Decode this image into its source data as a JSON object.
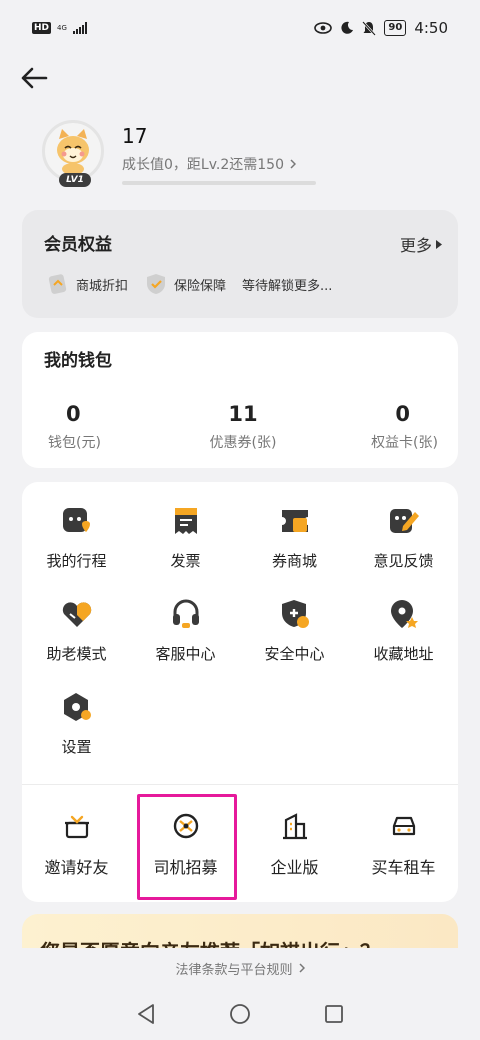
{
  "status_bar": {
    "hd": "HD",
    "network": "4G",
    "battery": "90",
    "time": "4:50"
  },
  "profile": {
    "phone": "17",
    "level_badge": "LV1",
    "growth_text": "成长值0，距Lv.2还需150",
    "growth_progress": 0
  },
  "member": {
    "title": "会员权益",
    "more": "更多",
    "benefits": [
      "商城折扣",
      "保险保障",
      "等待解锁更多..."
    ]
  },
  "wallet": {
    "title": "我的钱包",
    "stats": [
      {
        "value": "0",
        "label": "钱包(元)"
      },
      {
        "value": "11",
        "label": "优惠券(张)"
      },
      {
        "value": "0",
        "label": "权益卡(张)"
      }
    ]
  },
  "services": {
    "items": [
      {
        "label": "我的行程",
        "icon": "trip-icon"
      },
      {
        "label": "发票",
        "icon": "invoice-icon"
      },
      {
        "label": "券商城",
        "icon": "coupon-mall-icon"
      },
      {
        "label": "意见反馈",
        "icon": "feedback-icon"
      },
      {
        "label": "助老模式",
        "icon": "elder-mode-icon"
      },
      {
        "label": "客服中心",
        "icon": "headset-icon"
      },
      {
        "label": "安全中心",
        "icon": "shield-icon"
      },
      {
        "label": "收藏地址",
        "icon": "location-pin-icon"
      },
      {
        "label": "设置",
        "icon": "settings-icon"
      }
    ],
    "secondary": [
      {
        "label": "邀请好友",
        "icon": "gift-icon"
      },
      {
        "label": "司机招募",
        "icon": "steering-wheel-icon"
      },
      {
        "label": "企业版",
        "icon": "building-icon"
      },
      {
        "label": "买车租车",
        "icon": "car-icon"
      }
    ]
  },
  "banner": {
    "text": "您是否愿意向亲友推荐「如祺出行」？"
  },
  "footer": {
    "legal": "法律条款与平台规则"
  },
  "colors": {
    "accent": "#f5a623",
    "highlight": "#e6199b",
    "icon_dark": "#3a3a3a"
  }
}
